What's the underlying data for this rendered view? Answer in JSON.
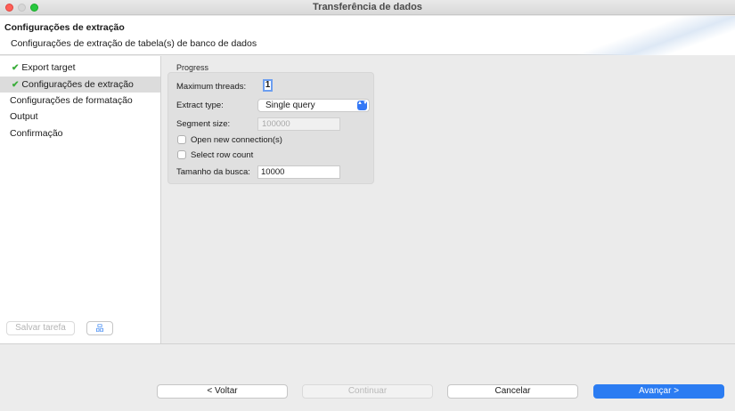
{
  "window": {
    "title": "Transferência de dados"
  },
  "header": {
    "title": "Configurações de extração",
    "subtitle": "Configurações de extração de tabela(s) de banco de dados"
  },
  "sidebar": {
    "check_glyph": "✔",
    "items": [
      {
        "label": "Export target",
        "checked": true
      },
      {
        "label": "Configurações de extração",
        "checked": true,
        "selected": true
      },
      {
        "label": "Configurações de formatação"
      },
      {
        "label": "Output"
      },
      {
        "label": "Confirmação"
      }
    ],
    "save_task_label": "Salvar tarefa",
    "tree_icon_glyph": "品"
  },
  "progress": {
    "group_label": "Progress",
    "max_threads_label": "Maximum threads:",
    "max_threads_value": "1",
    "extract_type_label": "Extract type:",
    "extract_type_value": "Single query",
    "select_arrow_glyph": "▲▼",
    "segment_size_label": "Segment size:",
    "segment_size_value": "100000",
    "open_new_connection_label": "Open new connection(s)",
    "select_row_count_label": "Select row count",
    "fetch_size_label": "Tamanho da busca:",
    "fetch_size_value": "10000"
  },
  "footer": {
    "back_label": "< Voltar",
    "continue_label": "Continuar",
    "cancel_label": "Cancelar",
    "next_label": "Avançar >"
  },
  "colors": {
    "accent": "#2b7cf2",
    "check": "#3cae3c"
  }
}
